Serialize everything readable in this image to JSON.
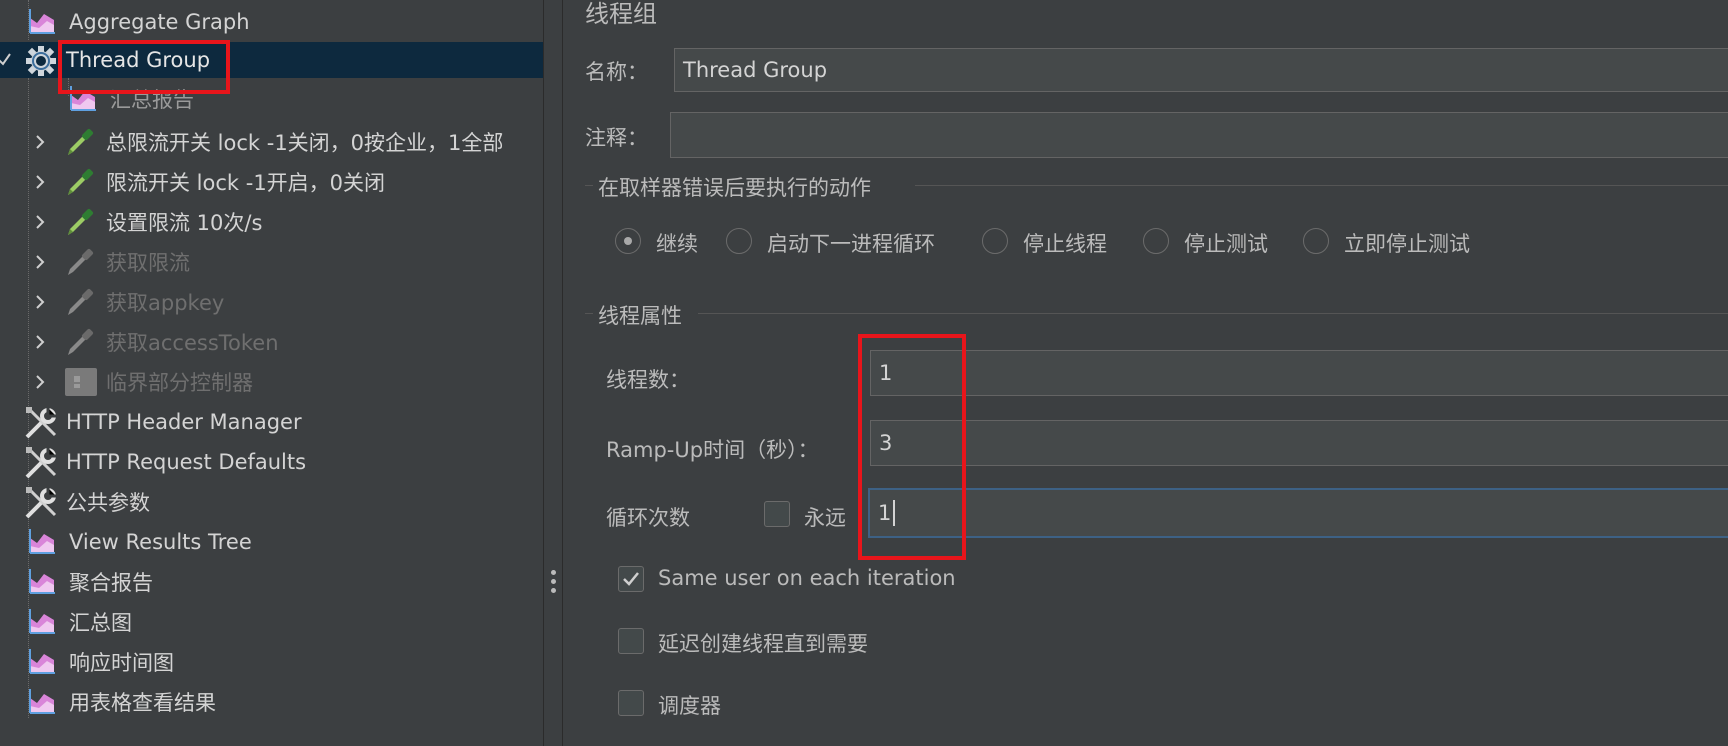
{
  "tree": {
    "items": [
      {
        "label": "Aggregate Graph",
        "icon": "graph-icon",
        "disabled": false
      },
      {
        "label": "Thread Group",
        "icon": "gear-icon",
        "disabled": false,
        "selected": true
      },
      {
        "label": "汇总报告",
        "icon": "graph-icon",
        "disabled": false
      },
      {
        "label": "总限流开关 lock  -1关闭，0按企业，1全部",
        "icon": "pipette-icon",
        "disabled": false
      },
      {
        "label": "限流开关 lock -1开启，0关闭",
        "icon": "pipette-icon",
        "disabled": false
      },
      {
        "label": "设置限流   10次/s",
        "icon": "pipette-icon",
        "disabled": false
      },
      {
        "label": "获取限流",
        "icon": "pipette-icon",
        "disabled": true
      },
      {
        "label": "获取appkey",
        "icon": "pipette-icon",
        "disabled": true
      },
      {
        "label": "获取accessToken",
        "icon": "pipette-icon",
        "disabled": true
      },
      {
        "label": "临界部分控制器",
        "icon": "controller-icon",
        "disabled": true
      },
      {
        "label": "HTTP Header Manager",
        "icon": "wrench-icon",
        "disabled": false
      },
      {
        "label": "HTTP Request Defaults",
        "icon": "wrench-icon",
        "disabled": false
      },
      {
        "label": "公共参数",
        "icon": "wrench-icon",
        "disabled": false
      },
      {
        "label": "View Results Tree",
        "icon": "graph-icon",
        "disabled": false
      },
      {
        "label": "聚合报告",
        "icon": "graph-icon",
        "disabled": false
      },
      {
        "label": "汇总图",
        "icon": "graph-icon",
        "disabled": false
      },
      {
        "label": "响应时间图",
        "icon": "graph-icon",
        "disabled": false
      },
      {
        "label": "用表格查看结果",
        "icon": "graph-icon",
        "disabled": false
      }
    ]
  },
  "panel": {
    "title": "线程组",
    "name_label": "名称：",
    "name_value": "Thread Group",
    "comment_label": "注释：",
    "comment_value": "",
    "error_action_group": "在取样器错误后要执行的动作",
    "error_actions": [
      {
        "label": "继续",
        "selected": true
      },
      {
        "label": "启动下一进程循环",
        "selected": false
      },
      {
        "label": "停止线程",
        "selected": false
      },
      {
        "label": "停止测试",
        "selected": false
      },
      {
        "label": "立即停止测试",
        "selected": false
      }
    ],
    "thread_props_group": "线程属性",
    "threads_label": "线程数：",
    "threads_value": "1",
    "rampup_label": "Ramp-Up时间（秒）：",
    "rampup_value": "3",
    "loop_label": "循环次数",
    "forever_label": "永远",
    "forever_checked": false,
    "loop_value": "1",
    "same_user_label": "Same user on each iteration",
    "same_user_checked": true,
    "delay_label": "延迟创建线程直到需要",
    "delay_checked": false,
    "scheduler_label": "调度器",
    "scheduler_checked": false
  },
  "colors": {
    "background": "#3c3f41",
    "selection": "#0d293e",
    "highlight_box": "#e8151b",
    "field_bg": "#45494a",
    "focus_border": "#3d6185"
  }
}
